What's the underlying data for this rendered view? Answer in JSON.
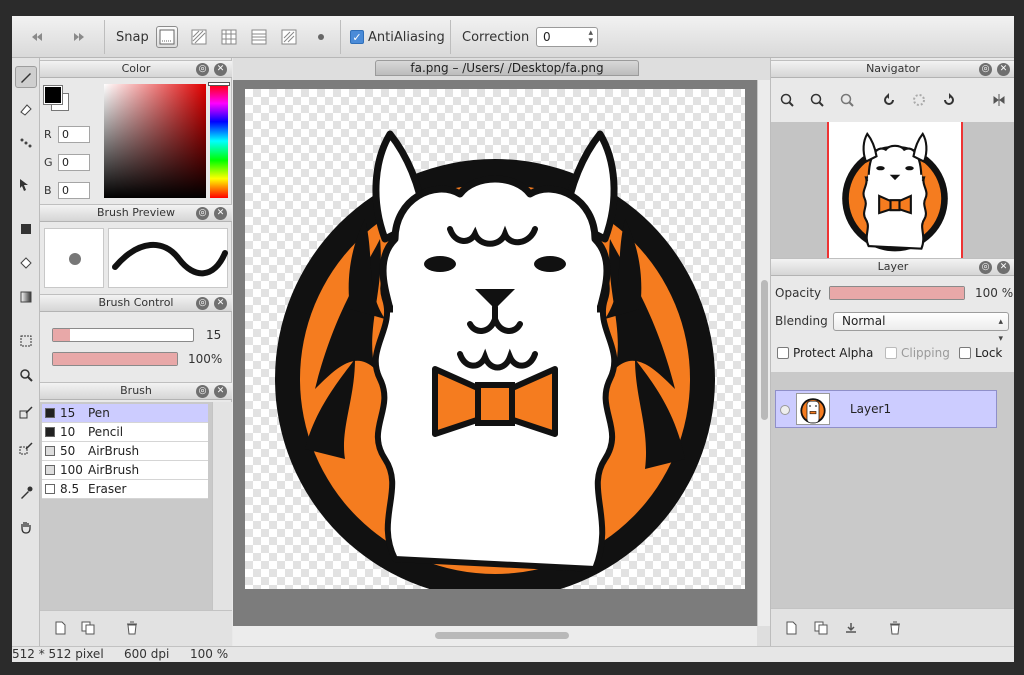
{
  "toolbar": {
    "snap_label": "Snap",
    "antialiasing_label": "AntiAliasing",
    "antialiasing_checked": true,
    "correction_label": "Correction",
    "correction_value": "0"
  },
  "color_panel": {
    "title": "Color",
    "r_label": "R",
    "r_value": "0",
    "g_label": "G",
    "g_value": "0",
    "b_label": "B",
    "b_value": "0"
  },
  "brush_preview_panel": {
    "title": "Brush Preview"
  },
  "brush_control_panel": {
    "title": "Brush Control",
    "size_value": "15",
    "opacity_value": "100%",
    "size_fraction": 0.12,
    "opacity_fraction": 1.0
  },
  "brush_panel": {
    "title": "Brush",
    "items": [
      {
        "size": "15",
        "name": "Pen",
        "swatch": "#222222",
        "selected": true
      },
      {
        "size": "10",
        "name": "Pencil",
        "swatch": "#222222",
        "selected": false
      },
      {
        "size": "50",
        "name": "AirBrush",
        "swatch": "#dddddd",
        "selected": false
      },
      {
        "size": "100",
        "name": "AirBrush",
        "swatch": "#dddddd",
        "selected": false
      },
      {
        "size": "8.5",
        "name": "Eraser",
        "swatch": "#ffffff",
        "selected": false
      }
    ]
  },
  "document": {
    "tab_title": "fa.png – /Users/           /Desktop/fa.png"
  },
  "navigator_panel": {
    "title": "Navigator"
  },
  "layer_panel": {
    "title": "Layer",
    "opacity_label": "Opacity",
    "opacity_value": "100 %",
    "blending_label": "Blending",
    "blending_value": "Normal",
    "protect_alpha_label": "Protect Alpha",
    "clipping_label": "Clipping",
    "lock_label": "Lock",
    "layers": [
      {
        "name": "Layer1"
      }
    ]
  },
  "status": {
    "size": "512 * 512 pixel",
    "dpi": "600 dpi",
    "zoom": "100 %"
  },
  "colors": {
    "accent_orange": "#f57c1f",
    "layer_selected": "#ccccff",
    "slider_fill": "#e8a8a8"
  }
}
